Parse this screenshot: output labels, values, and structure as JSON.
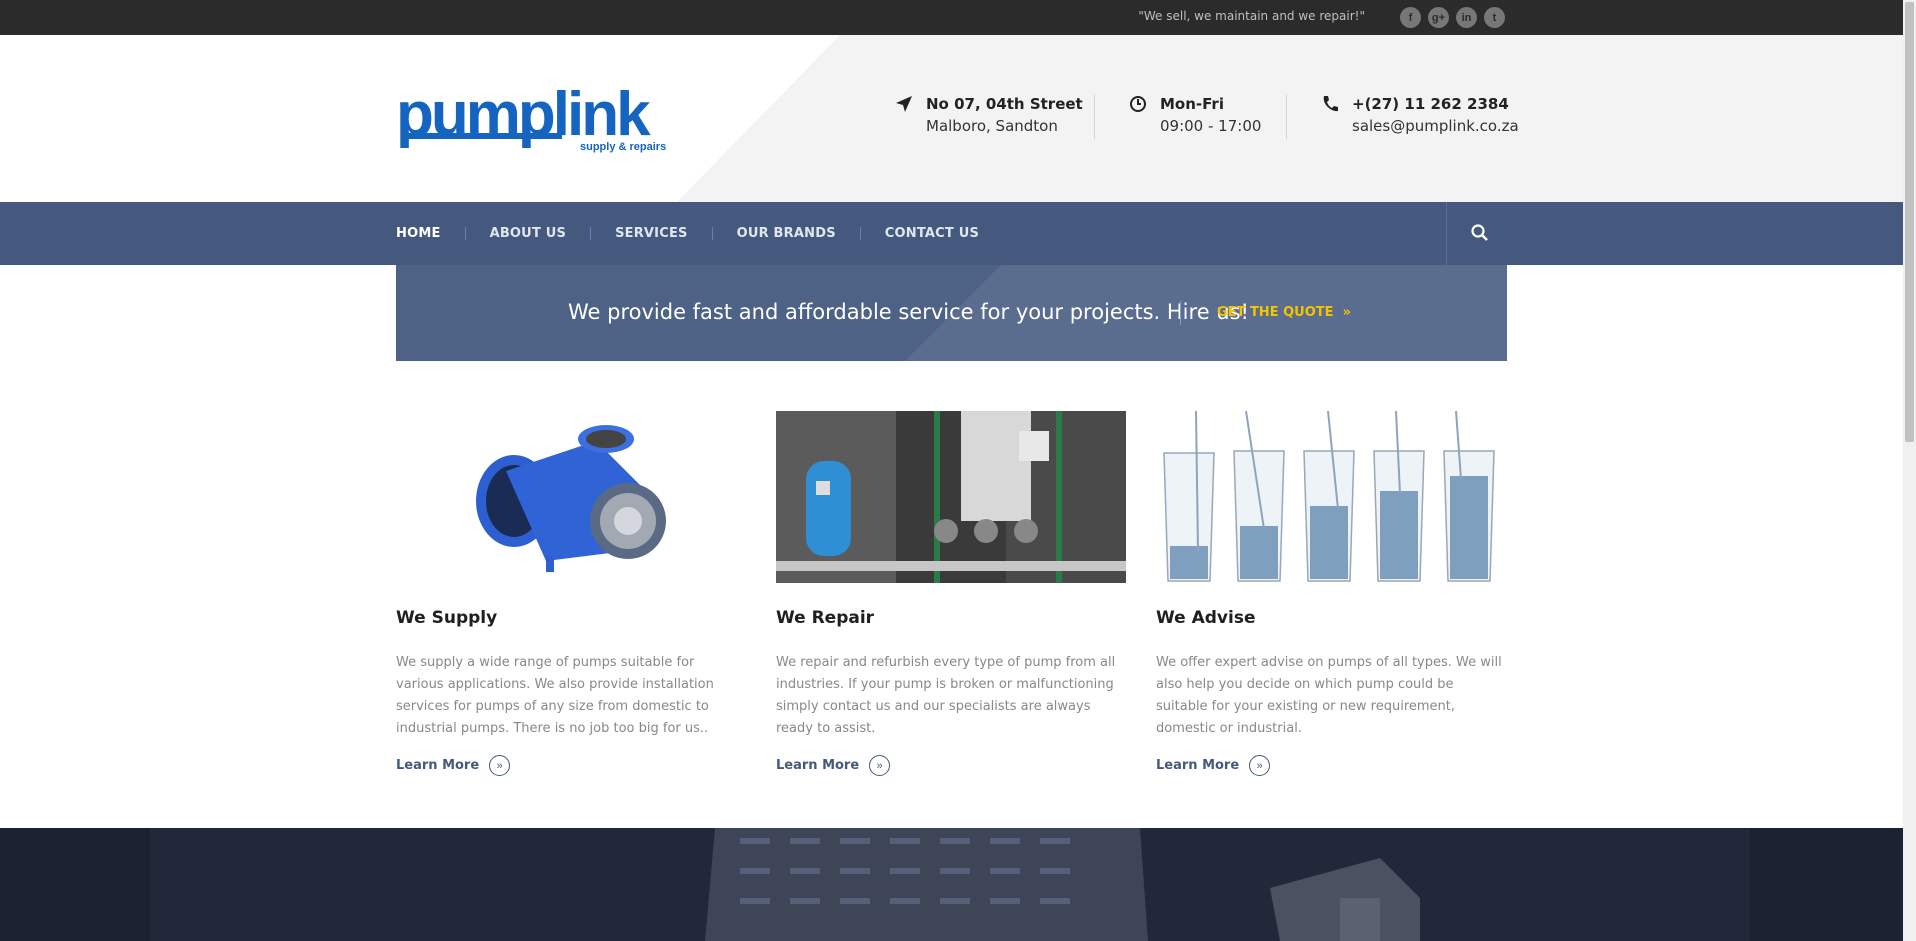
{
  "topbar": {
    "tagline": "\"We sell, we maintain and we repair!\"",
    "socials": [
      {
        "icon": "facebook-icon",
        "glyph": "f"
      },
      {
        "icon": "google-plus-icon",
        "glyph": "g+"
      },
      {
        "icon": "linkedin-icon",
        "glyph": "in"
      },
      {
        "icon": "twitter-icon",
        "glyph": "t"
      }
    ]
  },
  "header": {
    "logo_text": "pumplink",
    "logo_sub": "supply & repairs",
    "address": {
      "icon": "location-arrow-icon",
      "line1": "No 07, 04th Street",
      "line2": "Malboro, Sandton"
    },
    "hours": {
      "icon": "clock-icon",
      "line1": "Mon-Fri",
      "line2": "09:00 - 17:00"
    },
    "contact": {
      "icon": "phone-icon",
      "line1": "+(27) 11 262 2384",
      "line2": "sales@pumplink.co.za"
    }
  },
  "nav": {
    "items": [
      "HOME",
      "ABOUT US",
      "SERVICES",
      "OUR BRANDS",
      "CONTACT US"
    ],
    "active": "HOME",
    "search_icon": "search-icon"
  },
  "banner": {
    "text": "We provide fast and affordable service for your projects. Hire us!",
    "cta": "GET THE QUOTE",
    "cta_icon": "double-chevron-right-icon"
  },
  "features": [
    {
      "title": "We Supply",
      "text": "We supply a wide range of pumps suitable for various applications. We also provide installation services for pumps of any size from domestic to industrial pumps. There is no job too big for us..",
      "link": "Learn More"
    },
    {
      "title": "We Repair",
      "text": "We repair and refurbish every type of pump from all industries. If your pump is broken or malfunctioning simply contact us and our specialists are always ready to assist.",
      "link": "Learn More"
    },
    {
      "title": "We Advise",
      "text": "We offer expert advise on pumps of all types. We will also help you decide on which pump could be suitable for your existing or new requirement, domestic or industrial.",
      "link": "Learn More"
    }
  ],
  "colors": {
    "nav_bg": "#44597d",
    "banner_bg": "#4e6285",
    "cta": "#f5c400",
    "logo_blue": "#1565c0",
    "topbar": "#2b2b2b"
  }
}
